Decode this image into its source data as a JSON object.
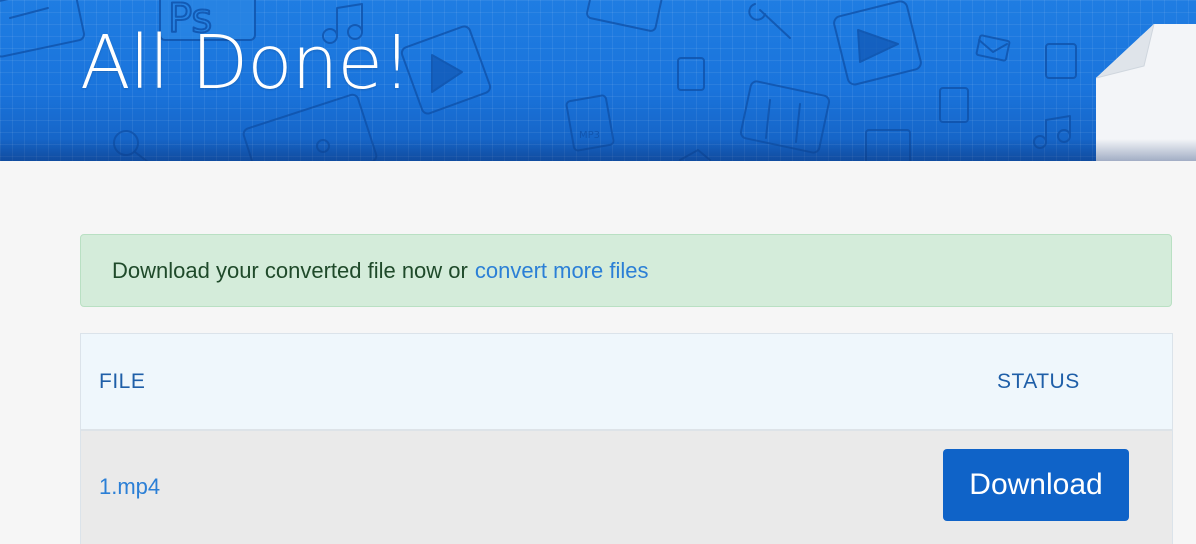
{
  "hero": {
    "title": "All Done!",
    "background_color": "#1a74dc"
  },
  "alert": {
    "message": "Download your converted file now or",
    "link_text": "convert more files",
    "background_color": "#d4ecda",
    "text_color": "#1f4a2a",
    "link_color": "#2b7fd6"
  },
  "table": {
    "headers": {
      "file": "FILE",
      "status": "STATUS"
    },
    "rows": [
      {
        "file_name": "1.mp4",
        "action_label": "Download"
      }
    ]
  },
  "colors": {
    "accent": "#0f63c8",
    "header_text": "#1f5fa8"
  }
}
